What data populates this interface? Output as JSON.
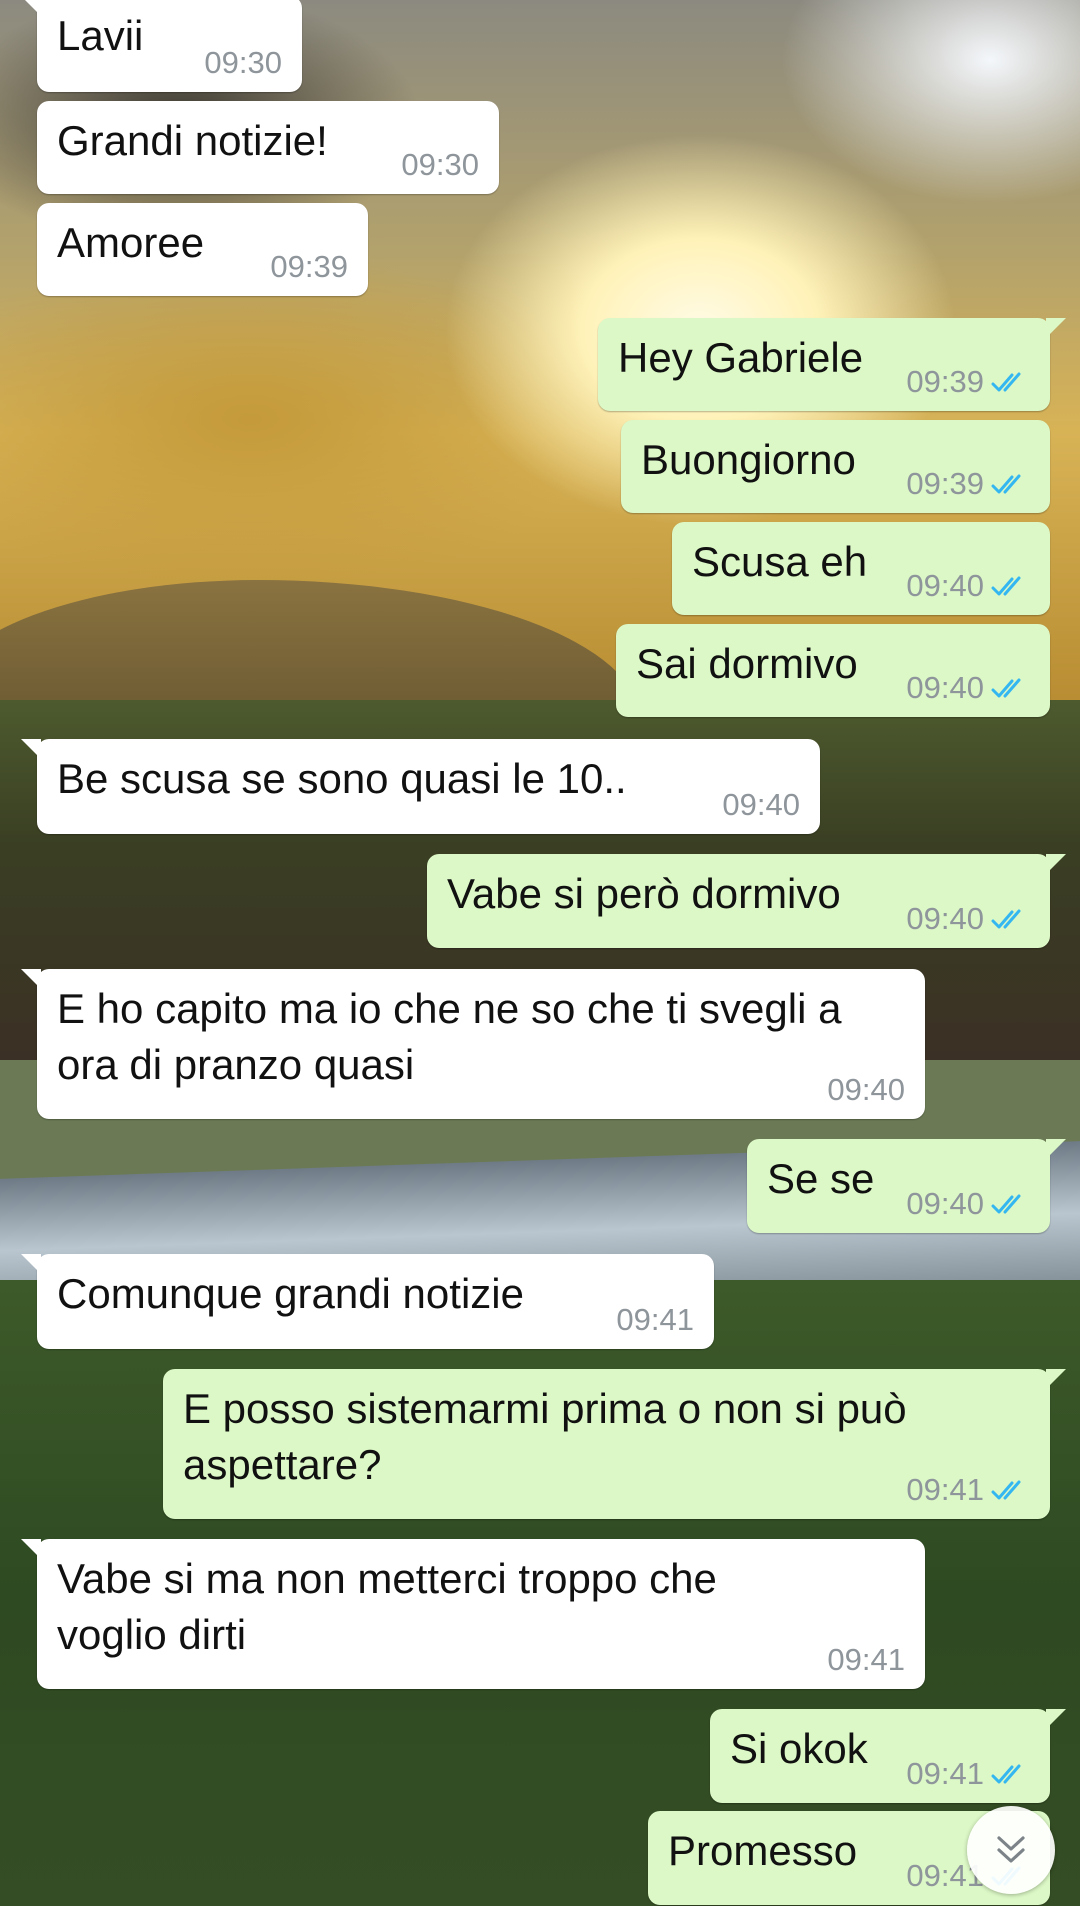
{
  "colors": {
    "incoming_bubble": "#ffffff",
    "outgoing_bubble": "#dcf8c6",
    "read_tick": "#34b7f1",
    "timestamp": "#8e959b"
  },
  "messages": [
    {
      "direction": "incoming",
      "text": "Lavii",
      "time": "09:30"
    },
    {
      "direction": "incoming",
      "text": "Grandi notizie!",
      "time": "09:30"
    },
    {
      "direction": "incoming",
      "text": "Amoree",
      "time": "09:39"
    },
    {
      "direction": "outgoing",
      "text": "Hey Gabriele",
      "time": "09:39",
      "status": "read"
    },
    {
      "direction": "outgoing",
      "text": "Buongiorno",
      "time": "09:39",
      "status": "read"
    },
    {
      "direction": "outgoing",
      "text": "Scusa eh",
      "time": "09:40",
      "status": "read"
    },
    {
      "direction": "outgoing",
      "text": "Sai dormivo",
      "time": "09:40",
      "status": "read"
    },
    {
      "direction": "incoming",
      "text": "Be scusa se sono quasi le 10..",
      "time": "09:40"
    },
    {
      "direction": "outgoing",
      "text": "Vabe si però dormivo",
      "time": "09:40",
      "status": "read"
    },
    {
      "direction": "incoming",
      "lines": [
        "E ho capito ma io che ne so che ti svegli a",
        "ora di pranzo quasi"
      ],
      "time": "09:40"
    },
    {
      "direction": "outgoing",
      "text": "Se se",
      "time": "09:40",
      "status": "read"
    },
    {
      "direction": "incoming",
      "text": "Comunque grandi notizie",
      "time": "09:41"
    },
    {
      "direction": "outgoing",
      "lines": [
        "E posso sistemarmi prima o non si può",
        "aspettare?"
      ],
      "time": "09:41",
      "status": "read"
    },
    {
      "direction": "incoming",
      "lines": [
        "Vabe si ma non metterci troppo che",
        "voglio dirti"
      ],
      "time": "09:41"
    },
    {
      "direction": "outgoing",
      "text": "Si okok",
      "time": "09:41",
      "status": "read"
    },
    {
      "direction": "outgoing",
      "text": "Promesso",
      "time": "09:41",
      "status": "read"
    }
  ],
  "scroll_button": {
    "icon": "double-chevron-down-icon"
  }
}
